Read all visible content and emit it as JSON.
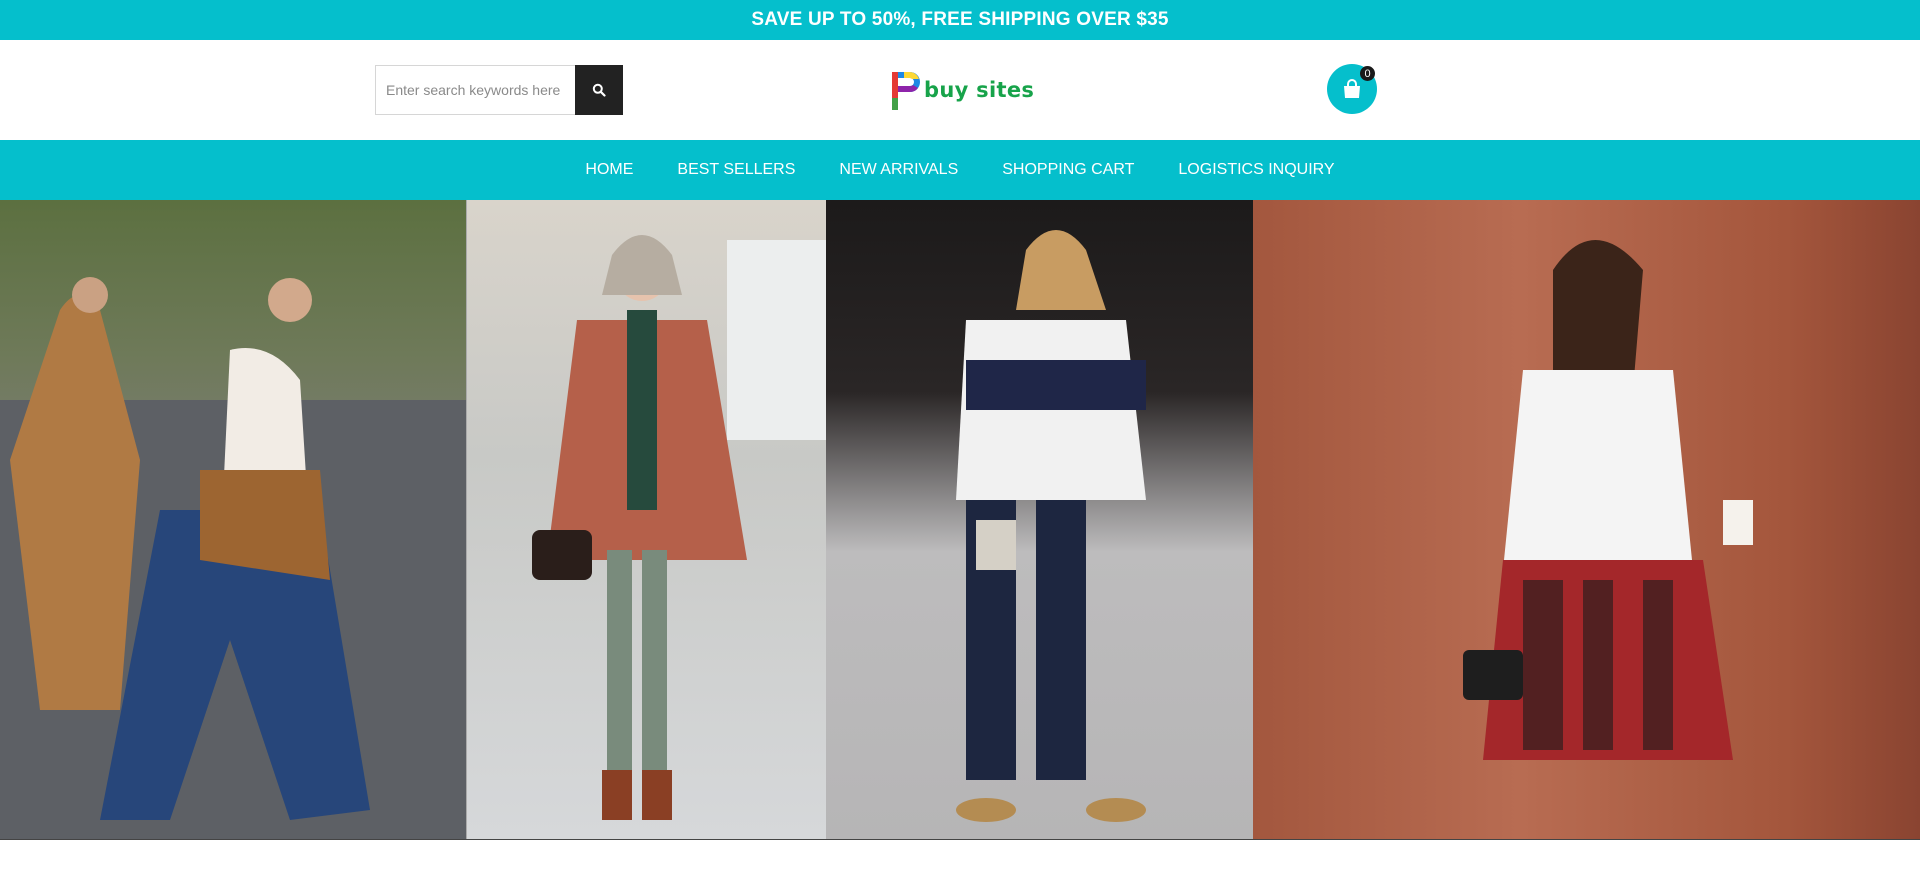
{
  "promo": {
    "text": "SAVE UP TO 50%, FREE SHIPPING OVER $35"
  },
  "search": {
    "placeholder": "Enter search keywords here",
    "icon": "search-icon"
  },
  "logo": {
    "text": "buy sites",
    "icon": "logo-mark-icon"
  },
  "cart": {
    "count": "0",
    "icon": "shopping-bag-icon"
  },
  "nav": {
    "items": [
      {
        "label": "HOME"
      },
      {
        "label": "BEST SELLERS"
      },
      {
        "label": "NEW ARRIVALS"
      },
      {
        "label": "SHOPPING CART"
      },
      {
        "label": "LOGISTICS INQUIRY"
      }
    ]
  },
  "colors": {
    "accent": "#05bfcc",
    "dark": "#222222",
    "logo_green": "#17a34a"
  }
}
